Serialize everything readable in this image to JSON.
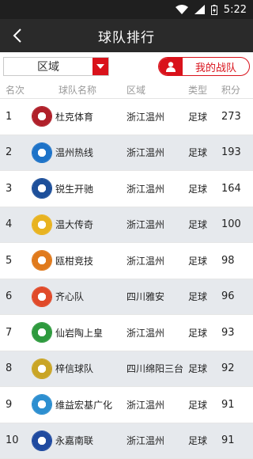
{
  "status": {
    "time": "5:22"
  },
  "header": {
    "title": "球队排行"
  },
  "filter": {
    "region_label": "区域",
    "my_team_label": "我的战队"
  },
  "table": {
    "columns": [
      "名次",
      "球队名称",
      "区域",
      "类型",
      "积分"
    ],
    "rows": [
      {
        "rank": "1",
        "team": "杜克体育",
        "region": "浙江温州",
        "type": "足球",
        "points": "273",
        "logo_color": "#b0202a"
      },
      {
        "rank": "2",
        "team": "温州热线",
        "region": "浙江温州",
        "type": "足球",
        "points": "193",
        "logo_color": "#1e73c8"
      },
      {
        "rank": "3",
        "team": "锐生开驰",
        "region": "浙江温州",
        "type": "足球",
        "points": "164",
        "logo_color": "#1d4f9a"
      },
      {
        "rank": "4",
        "team": "温大传奇",
        "region": "浙江温州",
        "type": "足球",
        "points": "100",
        "logo_color": "#e8b321"
      },
      {
        "rank": "5",
        "team": "瓯柑竞技",
        "region": "浙江温州",
        "type": "足球",
        "points": "98",
        "logo_color": "#e07a1c"
      },
      {
        "rank": "6",
        "team": "齐心队",
        "region": "四川雅安",
        "type": "足球",
        "points": "96",
        "logo_color": "#e04a2a"
      },
      {
        "rank": "7",
        "team": "仙岩陶上皇",
        "region": "浙江温州",
        "type": "足球",
        "points": "93",
        "logo_color": "#2e9a3e"
      },
      {
        "rank": "8",
        "team": "梓信球队",
        "region": "四川绵阳三台",
        "type": "足球",
        "points": "92",
        "logo_color": "#c9a526"
      },
      {
        "rank": "9",
        "team": "维益宏基广化",
        "region": "浙江温州",
        "type": "足球",
        "points": "91",
        "logo_color": "#2d8fd0"
      },
      {
        "rank": "10",
        "team": "永嘉南联",
        "region": "浙江温州",
        "type": "足球",
        "points": "91",
        "logo_color": "#1f4aa0"
      }
    ]
  }
}
